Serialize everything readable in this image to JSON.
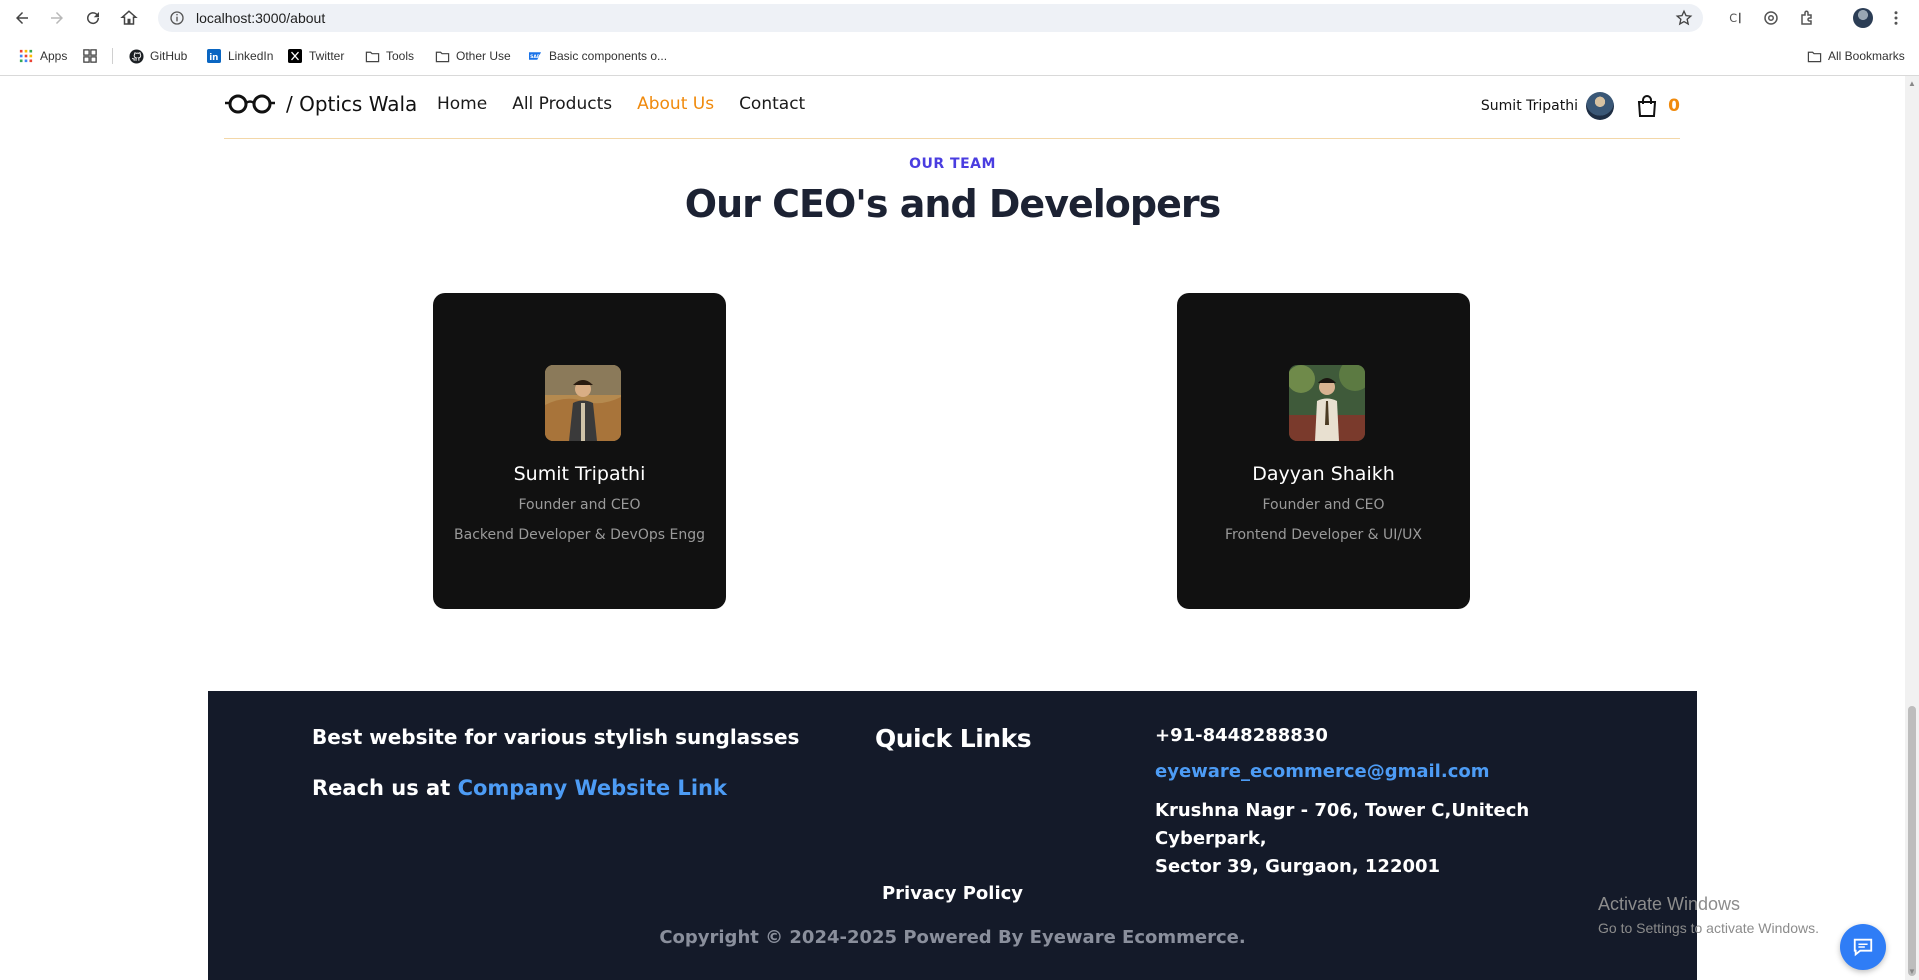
{
  "browser": {
    "url": "localhost:3000/about",
    "bookmarks": [
      {
        "label": "Apps",
        "icon": "apps-grid-icon"
      },
      {
        "label": "GitHub",
        "icon": "github-icon"
      },
      {
        "label": "LinkedIn",
        "icon": "linkedin-icon"
      },
      {
        "label": "Twitter",
        "icon": "x-twitter-icon"
      },
      {
        "label": "Tools",
        "icon": "folder-icon"
      },
      {
        "label": "Other Use",
        "icon": "folder-icon"
      },
      {
        "label": "Basic components o...",
        "icon": "sap-icon"
      }
    ],
    "all_bookmarks_label": "All Bookmarks"
  },
  "site": {
    "brand": "/ Optics Wala",
    "nav": [
      {
        "label": "Home",
        "active": false
      },
      {
        "label": "All Products",
        "active": false
      },
      {
        "label": "About Us",
        "active": true
      },
      {
        "label": "Contact",
        "active": false
      }
    ],
    "user_name": "Sumit Tripathi",
    "cart_count": "0",
    "accent_color": "#f08a0c"
  },
  "team": {
    "eyebrow": "OUR TEAM",
    "title": "Our CEO's and Developers",
    "members": [
      {
        "name": "Sumit Tripathi",
        "role": "Founder and CEO",
        "description": "Backend Developer & DevOps Engg"
      },
      {
        "name": "Dayyan Shaikh",
        "role": "Founder and CEO",
        "description": "Frontend Developer & UI/UX"
      }
    ]
  },
  "footer": {
    "tagline": "Best website for various stylish sunglasses",
    "reach_prefix": "Reach us at",
    "reach_link": "Company Website Link",
    "quick_links_title": "Quick Links",
    "phone": "+91-8448288830",
    "email": "eyeware_ecommerce@gmail.com",
    "address_line1": "Krushna Nagr - 706, Tower C,Unitech Cyberpark,",
    "address_line2": "Sector 39, Gurgaon, 122001",
    "privacy": "Privacy Policy",
    "copyright": "Copyright © 2024-2025 Powered By Eyeware Ecommerce.",
    "bg_color": "#141a29",
    "link_color": "#4d9cf5"
  },
  "os_watermark": {
    "title": "Activate Windows",
    "subtitle": "Go to Settings to activate Windows."
  }
}
